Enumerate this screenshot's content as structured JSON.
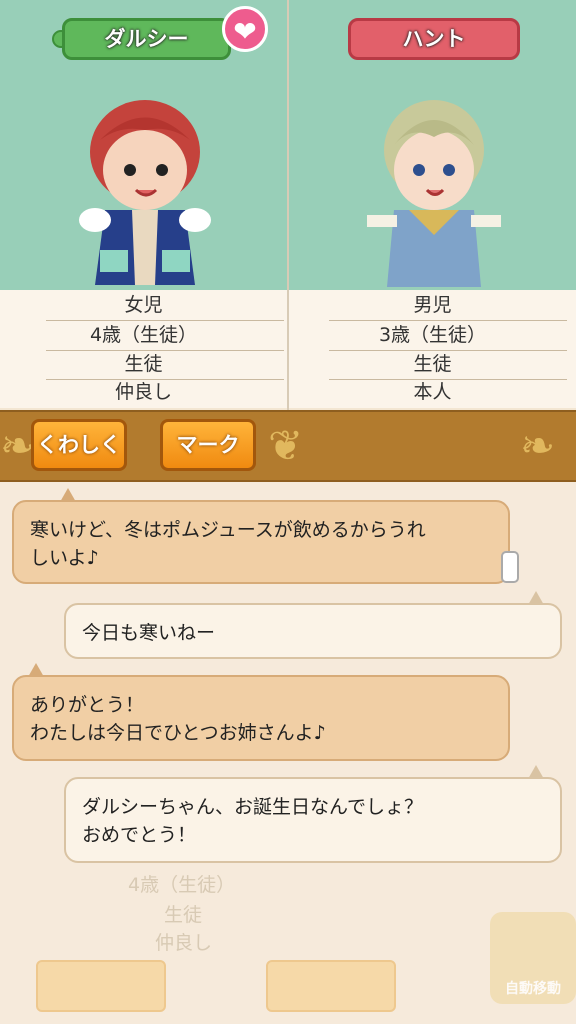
{
  "characters": {
    "left": {
      "name": "ダルシー",
      "info": [
        "女児",
        "4歳（生徒）",
        "生徒",
        "仲良し"
      ]
    },
    "right": {
      "name": "ハント",
      "info": [
        "男児",
        "3歳（生徒）",
        "生徒",
        "本人"
      ]
    }
  },
  "heart_icon": "heart-icon",
  "buttons": {
    "details": "くわしく",
    "mark": "マーク"
  },
  "messages": [
    {
      "from": "left",
      "text": "寒いけど、冬はポムジュースが飲めるからうれ\nしいよ♪"
    },
    {
      "from": "right",
      "text": "今日も寒いねー"
    },
    {
      "from": "left",
      "text": "ありがとう！\nわたしは今日でひとつお姉さんよ♪"
    },
    {
      "from": "right",
      "text": "ダルシーちゃん、お誕生日なんでしょ？\nおめでとう！"
    }
  ],
  "background_faded": {
    "info": [
      "4歳（生徒）",
      "生徒",
      "仲良し"
    ],
    "auto_move_label": "自動移動"
  },
  "colors": {
    "panel_bg": "#98cfb8",
    "bar": "#b27b2e",
    "button": "#f59a1c",
    "heart": "#ee5c8e"
  }
}
